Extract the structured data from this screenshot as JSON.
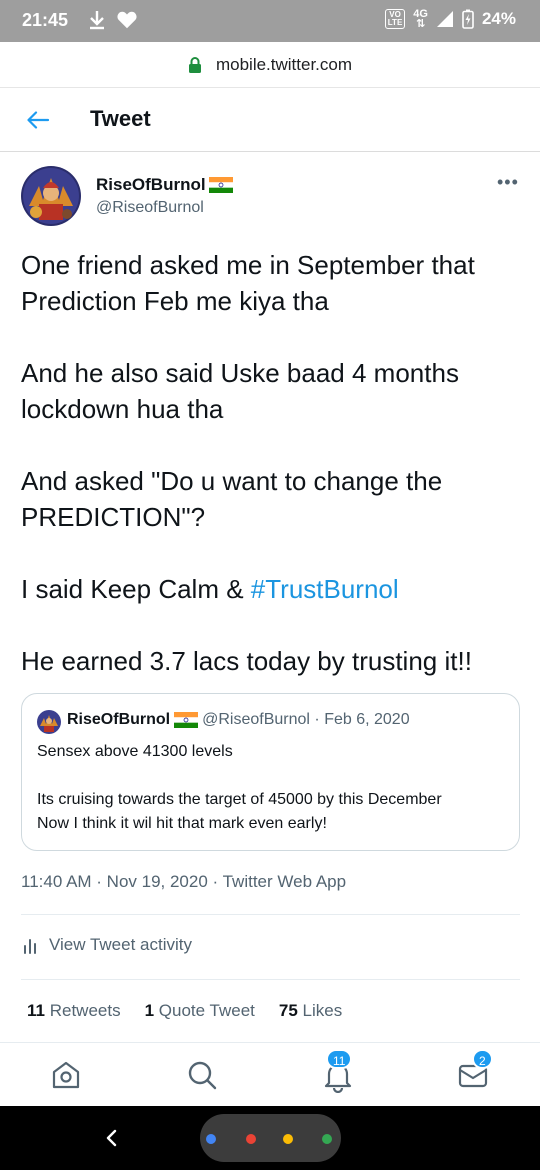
{
  "status_bar": {
    "time": "21:45",
    "volte_line1": "VO",
    "volte_line2": "LTE",
    "network": "4G",
    "battery": "24%"
  },
  "browser": {
    "url": "mobile.twitter.com"
  },
  "header": {
    "title": "Tweet"
  },
  "tweet": {
    "author_name": "RiseOfBurnol",
    "author_handle": "@RiseofBurnol",
    "paragraphs": [
      "One friend asked me in September that Prediction Feb me kiya tha",
      "And he also said Uske baad 4 months lockdown hua tha",
      "And asked \"Do u want to change the PREDICTION\"?"
    ],
    "line4_prefix": "I said Keep Calm & ",
    "hashtag": "#TrustBurnol",
    "line5": "He earned 3.7 lacs today by trusting it!!",
    "timestamp": "11:40 AM · Nov 19, 2020 · Twitter Web App",
    "activity_label": "View Tweet activity",
    "retweets_count": "11",
    "retweets_label": "Retweets",
    "quotes_count": "1",
    "quotes_label": "Quote Tweet",
    "likes_count": "75",
    "likes_label": "Likes"
  },
  "quoted_tweet": {
    "author_name": "RiseOfBurnol",
    "meta": "@RiseofBurnol · Feb 6, 2020",
    "line1": "Sensex above 41300 levels",
    "line2": "Its cruising towards the target of 45000 by this December",
    "line3": "Now I think it wil hit that mark even early!"
  },
  "bottom_nav": {
    "notifications_badge": "11",
    "messages_badge": "2"
  },
  "colors": {
    "accent": "#1d9bf0",
    "hashtag": "#1b95e0",
    "secondary_text": "#536471",
    "status_bar": "#9e9e9e"
  }
}
